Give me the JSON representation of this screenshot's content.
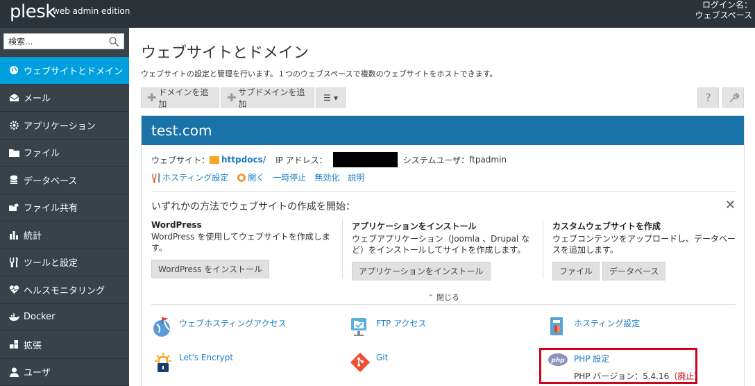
{
  "app": {
    "logo": "plesk",
    "edition": "web admin edition",
    "login_label": "ログイン名：",
    "login_value": "ウェブスペース"
  },
  "search": {
    "placeholder": "検索..."
  },
  "sidebar": {
    "items": [
      {
        "label": "ウェブサイトとドメイン",
        "icon": "globe-icon",
        "active": true
      },
      {
        "label": "メール",
        "icon": "mail-icon"
      },
      {
        "label": "アプリケーション",
        "icon": "gear-icon"
      },
      {
        "label": "ファイル",
        "icon": "folder-icon"
      },
      {
        "label": "データベース",
        "icon": "database-icon"
      },
      {
        "label": "ファイル共有",
        "icon": "share-icon"
      },
      {
        "label": "統計",
        "icon": "bar-chart-icon"
      },
      {
        "label": "ツールと設定",
        "icon": "tools-icon"
      },
      {
        "label": "ヘルスモニタリング",
        "icon": "heart-icon"
      },
      {
        "label": "Docker",
        "icon": "docker-icon"
      },
      {
        "label": "拡張",
        "icon": "extensions-icon"
      },
      {
        "label": "ユーザ",
        "icon": "user-icon"
      }
    ]
  },
  "main": {
    "title": "ウェブサイトとドメイン",
    "description": "ウェブサイトの設定と管理を行います。１つのウェブスペースで複数のウェブサイトをホストできます。",
    "toolbar": {
      "add_domain": "ドメインを追加",
      "add_subdomain": "サブドメインを追加",
      "menu": "☰ ▾",
      "help": "?",
      "settings": "🔧"
    }
  },
  "domain": {
    "name": "test.com",
    "website_label": "ウェブサイト：",
    "docroot": "httpdocs/",
    "ip_label": "IP アドレス：",
    "sysuser_label": "システムユーザ：",
    "sysuser": "ftpadmin",
    "actions": [
      "ホスティング設定",
      "開く",
      "一時停止",
      "無効化",
      "説明"
    ]
  },
  "start": {
    "title": "いずれかの方法でウェブサイトの作成を開始：",
    "columns": [
      {
        "title": "WordPress",
        "desc": "WordPress を使用してウェブサイトを作成します。",
        "buttons": [
          "WordPress をインストール"
        ]
      },
      {
        "title": "アプリケーションをインストール",
        "desc": "ウェブアプリケーション（Joomla 、Drupal など）をインストールしてサイトを作成します。",
        "buttons": [
          "アプリケーションをインストール"
        ]
      },
      {
        "title": "カスタムウェブサイトを作成",
        "desc": "ウェブコンテンツをアップロードし、データベースを追加します。",
        "buttons": [
          "ファイル",
          "データベース"
        ]
      }
    ],
    "close": "閉じる"
  },
  "tools": [
    {
      "label": "ウェブホスティングアクセス",
      "icon": "web-hosting-access-icon"
    },
    {
      "label": "FTP アクセス",
      "icon": "ftp-access-icon"
    },
    {
      "label": "ホスティング設定",
      "icon": "hosting-settings-icon"
    },
    {
      "label": "Let's Encrypt",
      "icon": "lets-encrypt-icon"
    },
    {
      "label": "Git",
      "icon": "git-icon"
    },
    {
      "label": "PHP 設定",
      "icon": "php-icon",
      "sub": "PHP バージョン：5.4.16",
      "sub_note": "（廃止）"
    }
  ],
  "colors": {
    "accent": "#00a0df",
    "card_header": "#1a73a8",
    "sidebar": "#3a4249",
    "topbar": "#2b3238",
    "highlight": "#d0021b"
  }
}
